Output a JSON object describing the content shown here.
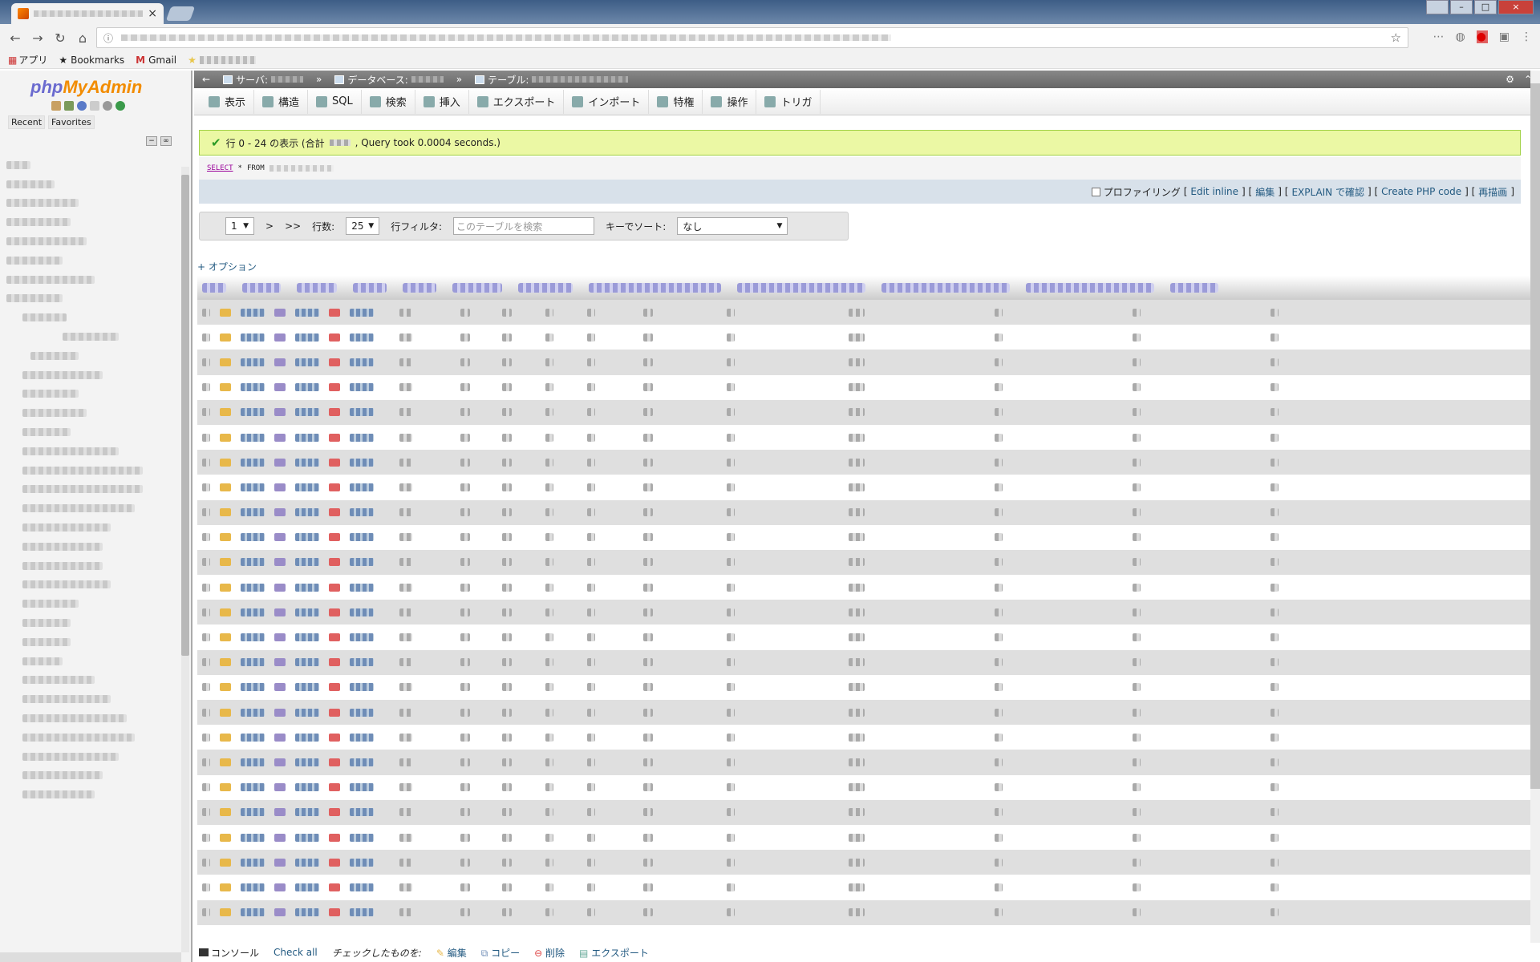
{
  "browser": {
    "bookmarks": {
      "apps_label": "アプリ",
      "bookmarks_label": "Bookmarks",
      "gmail_label": "Gmail"
    }
  },
  "pma": {
    "logo": {
      "php": "php",
      "myadmin": "MyAdmin"
    },
    "recent_label": "Recent",
    "favorites_label": "Favorites",
    "breadcrumb": {
      "server": "サーバ:",
      "database": "データベース:",
      "table": "テーブル:"
    },
    "tabs": [
      {
        "label": "表示"
      },
      {
        "label": "構造"
      },
      {
        "label": "SQL"
      },
      {
        "label": "検索"
      },
      {
        "label": "挿入"
      },
      {
        "label": "エクスポート"
      },
      {
        "label": "インポート"
      },
      {
        "label": "特権"
      },
      {
        "label": "操作"
      },
      {
        "label": "トリガ"
      }
    ],
    "success": {
      "prefix": "行 0 - 24 の表示 (合計",
      "suffix": ", Query took 0.0004 seconds.)"
    },
    "sql": {
      "select": "SELECT",
      "star": "*",
      "from": "FROM"
    },
    "sql_tools": {
      "profiling": "プロファイリング",
      "edit_inline": "Edit inline",
      "edit": "編集",
      "explain": "EXPLAIN で確認",
      "php_code": "Create PHP code",
      "refresh": "再描画"
    },
    "nav": {
      "page": "1",
      "next": ">",
      "last": ">>",
      "rows_label": "行数:",
      "rows_value": "25",
      "filter_label": "行フィルタ:",
      "filter_placeholder": "このテーブルを検索",
      "sort_label": "キーでソート:",
      "sort_value": "なし"
    },
    "options_label": "+ オプション",
    "footer": {
      "console": "コンソール",
      "check_all": "Check all",
      "with_selected": "チェックしたものを:",
      "edit": "編集",
      "copy": "コピー",
      "delete": "削除",
      "export": "エクスポート"
    }
  }
}
